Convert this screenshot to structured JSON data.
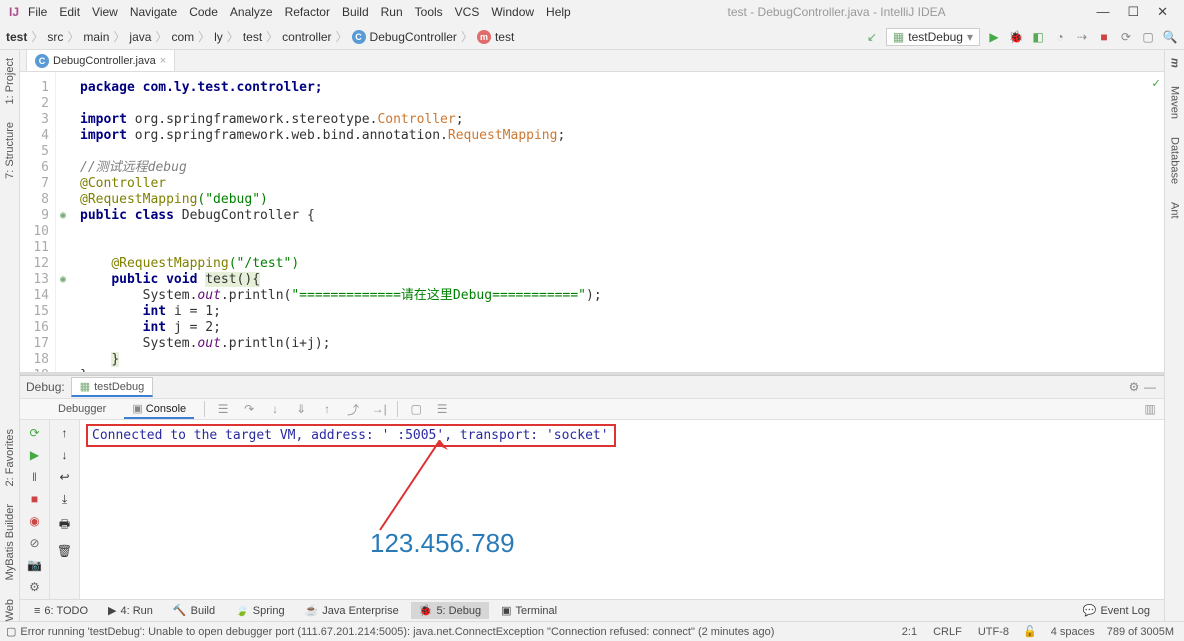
{
  "window": {
    "title": "test - DebugController.java - IntelliJ IDEA"
  },
  "menu": [
    "File",
    "Edit",
    "View",
    "Navigate",
    "Code",
    "Analyze",
    "Refactor",
    "Build",
    "Run",
    "Tools",
    "VCS",
    "Window",
    "Help"
  ],
  "breadcrumb": [
    "test",
    "src",
    "main",
    "java",
    "com",
    "ly",
    "test",
    "controller",
    "DebugController",
    "test"
  ],
  "run_config": {
    "label": "testDebug"
  },
  "file_tab": {
    "label": "DebugController.java"
  },
  "left_tools": [
    "1: Project",
    "7: Structure"
  ],
  "left_tools_b": [
    "2: Favorites",
    "MyBatis Builder",
    "Web"
  ],
  "right_tools": [
    "Maven",
    "Database",
    "Ant"
  ],
  "code": {
    "l1": "package com.ly.test.controller;",
    "l3a": "import ",
    "l3b": "org.springframework.stereotype.",
    "l3c": "Controller",
    "l3d": ";",
    "l4a": "import ",
    "l4b": "org.springframework.web.bind.annotation.",
    "l4c": "RequestMapping",
    "l4d": ";",
    "l6": "//测试远程debug",
    "l7": "@Controller",
    "l8a": "@RequestMapping",
    "l8b": "(\"debug\")",
    "l9a": "public class ",
    "l9b": "DebugController {",
    "l12a": "@RequestMapping",
    "l12b": "(\"/test\")",
    "l13a": "public void ",
    "l13b": "test(){",
    "l14a": "System.",
    "l14b": "out",
    "l14c": ".println(",
    "l14d": "\"=============请在这里Debug===========\"",
    "l14e": ");",
    "l15a": "int ",
    "l15b": "i = ",
    "l15c": "1",
    "l15d": ";",
    "l16a": "int ",
    "l16b": "j = ",
    "l16c": "2",
    "l16d": ";",
    "l17a": "System.",
    "l17b": "out",
    "l17c": ".println(i+j);",
    "l18": "}",
    "l19": "}"
  },
  "debug": {
    "title": "Debug:",
    "tab": "testDebug",
    "sub_tabs": {
      "debugger": "Debugger",
      "console": "Console"
    },
    "console_line": "Connected to the target VM, address: '           :5005', transport: 'socket'",
    "watermark": "123.456.789"
  },
  "bottom_tabs": {
    "todo": "6: TODO",
    "run": "4: Run",
    "build": "Build",
    "spring": "Spring",
    "jee": "Java Enterprise",
    "debug": "5: Debug",
    "terminal": "Terminal",
    "log": "Event Log"
  },
  "status": {
    "msg": "Error running 'testDebug': Unable to open debugger port (111.67.201.214:5005): java.net.ConnectException \"Connection refused: connect\" (2 minutes ago)",
    "pos": "2:1",
    "crlf": "CRLF",
    "enc": "UTF-8",
    "indent": "4 spaces",
    "mem": "789 of 3005M"
  }
}
